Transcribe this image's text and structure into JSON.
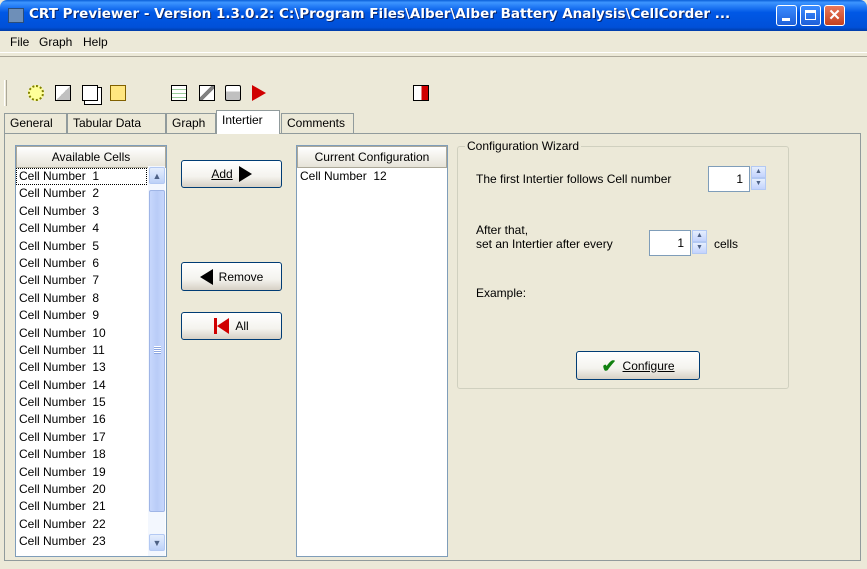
{
  "window": {
    "title": "CRT Previewer - Version 1.3.0.2: C:\\Program Files\\Alber\\Alber Battery Analysis\\CellCorder ..."
  },
  "menu": [
    "File",
    "Graph",
    "Help"
  ],
  "toolbar": {
    "icons": [
      "bulb-icon",
      "export-icon",
      "copy-icon",
      "report-icon",
      "edit-chart-icon",
      "settings-icon",
      "print-icon",
      "arrow-right-icon",
      "exit-icon"
    ]
  },
  "tabs": [
    "General",
    "Tabular Data",
    "Graph",
    "Intertier",
    "Comments"
  ],
  "available": {
    "header": "Available Cells",
    "items": [
      "Cell Number  1",
      "Cell Number  2",
      "Cell Number  3",
      "Cell Number  4",
      "Cell Number  5",
      "Cell Number  6",
      "Cell Number  7",
      "Cell Number  8",
      "Cell Number  9",
      "Cell Number  10",
      "Cell Number  11",
      "Cell Number  13",
      "Cell Number  14",
      "Cell Number  15",
      "Cell Number  16",
      "Cell Number  17",
      "Cell Number  18",
      "Cell Number  19",
      "Cell Number  20",
      "Cell Number  21",
      "Cell Number  22",
      "Cell Number  23"
    ]
  },
  "actions": {
    "add": "Add",
    "remove": "Remove",
    "all": "All"
  },
  "current": {
    "header": "Current Configuration",
    "items": [
      "Cell Number  12"
    ]
  },
  "wizard": {
    "title": "Configuration Wizard",
    "first_label": "The first Intertier follows Cell number",
    "first_value": "1",
    "after_line1": "After that,",
    "after_line2": "set an Intertier after every",
    "after_value": "1",
    "cells_label": "cells",
    "example_label": "Example:",
    "configure": "Configure"
  }
}
